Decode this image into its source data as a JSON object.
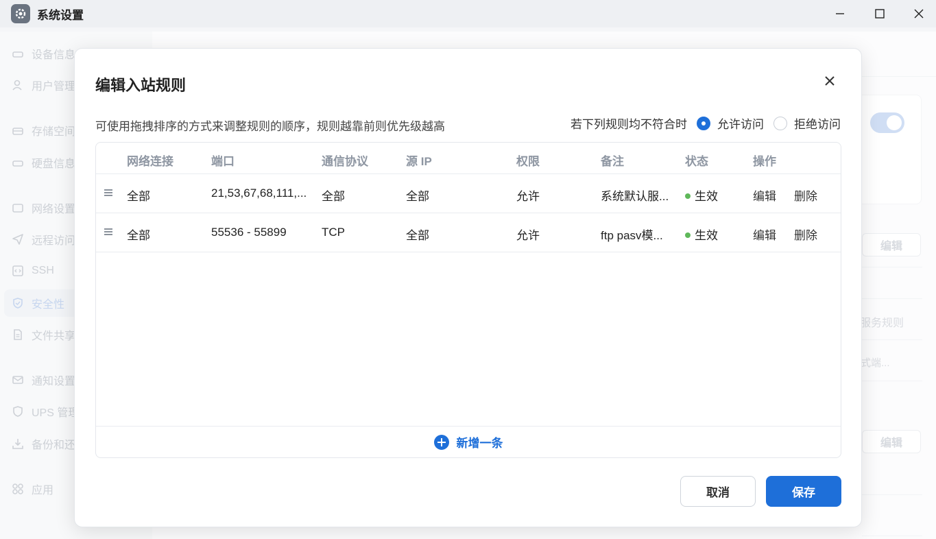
{
  "window": {
    "title": "系统设置"
  },
  "sidebar": {
    "items": [
      {
        "label": "设备信息",
        "icon": "device-icon"
      },
      {
        "label": "用户管理",
        "icon": "user-icon"
      },
      {
        "label": "存储空间",
        "icon": "storage-icon"
      },
      {
        "label": "硬盘信息",
        "icon": "disk-icon"
      },
      {
        "label": "网络设置",
        "icon": "network-icon"
      },
      {
        "label": "远程访问",
        "icon": "send-icon"
      },
      {
        "label": "SSH",
        "icon": "code-icon"
      },
      {
        "label": "安全性",
        "icon": "shield-icon"
      },
      {
        "label": "文件共享",
        "icon": "file-icon"
      },
      {
        "label": "通知设置",
        "icon": "mail-icon"
      },
      {
        "label": "UPS 管理",
        "icon": "ups-shield-icon"
      },
      {
        "label": "备份和还原",
        "icon": "backup-icon"
      },
      {
        "label": "应用",
        "icon": "apps-icon"
      }
    ],
    "active_index": 7
  },
  "background": {
    "edit_label_1": "编辑",
    "edit_label_2": "编辑",
    "text_service_rules": "服务规则",
    "text_mode_port": "模式端..."
  },
  "modal": {
    "title": "编辑入站规则",
    "hint": "可使用拖拽排序的方式来调整规则的顺序，规则越靠前则优先级越高",
    "default_label": "若下列规则均不符合时",
    "radio_allow": "允许访问",
    "radio_deny": "拒绝访问",
    "selected_default": "允许访问",
    "columns": [
      "网络连接",
      "端口",
      "通信协议",
      "源 IP",
      "权限",
      "备注",
      "状态",
      "操作"
    ],
    "rows": [
      {
        "network": "全部",
        "port": "21,53,67,68,111,...",
        "protocol": "全部",
        "source_ip": "全部",
        "permission": "允许",
        "note": "系统默认服...",
        "status": "生效",
        "edit": "编辑",
        "delete": "删除"
      },
      {
        "network": "全部",
        "port": "55536 - 55899",
        "protocol": "TCP",
        "source_ip": "全部",
        "permission": "允许",
        "note": "ftp pasv模...",
        "status": "生效",
        "edit": "编辑",
        "delete": "删除"
      }
    ],
    "add_label": "新增一条",
    "cancel_label": "取消",
    "save_label": "保存"
  },
  "colors": {
    "accent": "#1e6fd9",
    "status_active": "#5fb85a"
  }
}
